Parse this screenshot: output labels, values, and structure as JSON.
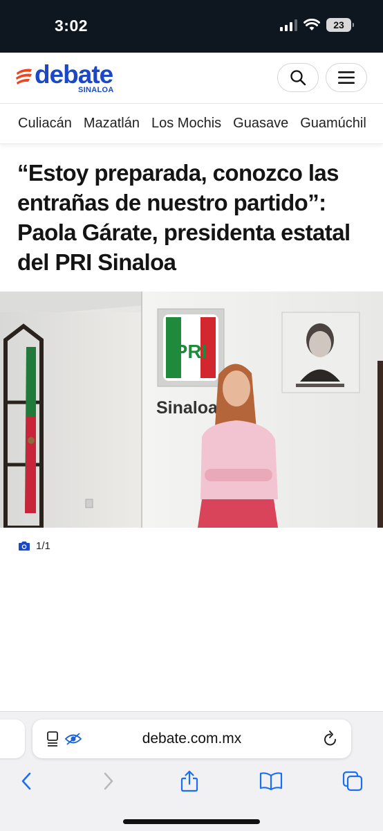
{
  "status_bar": {
    "time": "3:02",
    "battery": "23",
    "icons": [
      "cellular-signal-icon",
      "wifi-icon",
      "battery-icon"
    ]
  },
  "header": {
    "logo_word": "debate",
    "logo_sub": "SINALOA",
    "brand_color": "#1b48c4",
    "accent_color": "#f0441f",
    "buttons": [
      "search-icon",
      "hamburger-menu-icon"
    ]
  },
  "nav": {
    "cities": [
      "Culiacán",
      "Mazatlán",
      "Los Mochis",
      "Guasave",
      "Guamúchil"
    ]
  },
  "article": {
    "headline": "“Estoy preparada, conozco las entrañas de nuestro partido”: Paola Gárate, presidenta estatal del PRI Sinaloa",
    "photo_sign": "Sinaloa",
    "photo_logo": "PRI",
    "photo_count": "1/1"
  },
  "browser": {
    "url": "debate.com.mx",
    "toolbar": [
      "back-icon",
      "forward-icon",
      "share-icon",
      "bookmarks-icon",
      "tabs-icon"
    ]
  }
}
